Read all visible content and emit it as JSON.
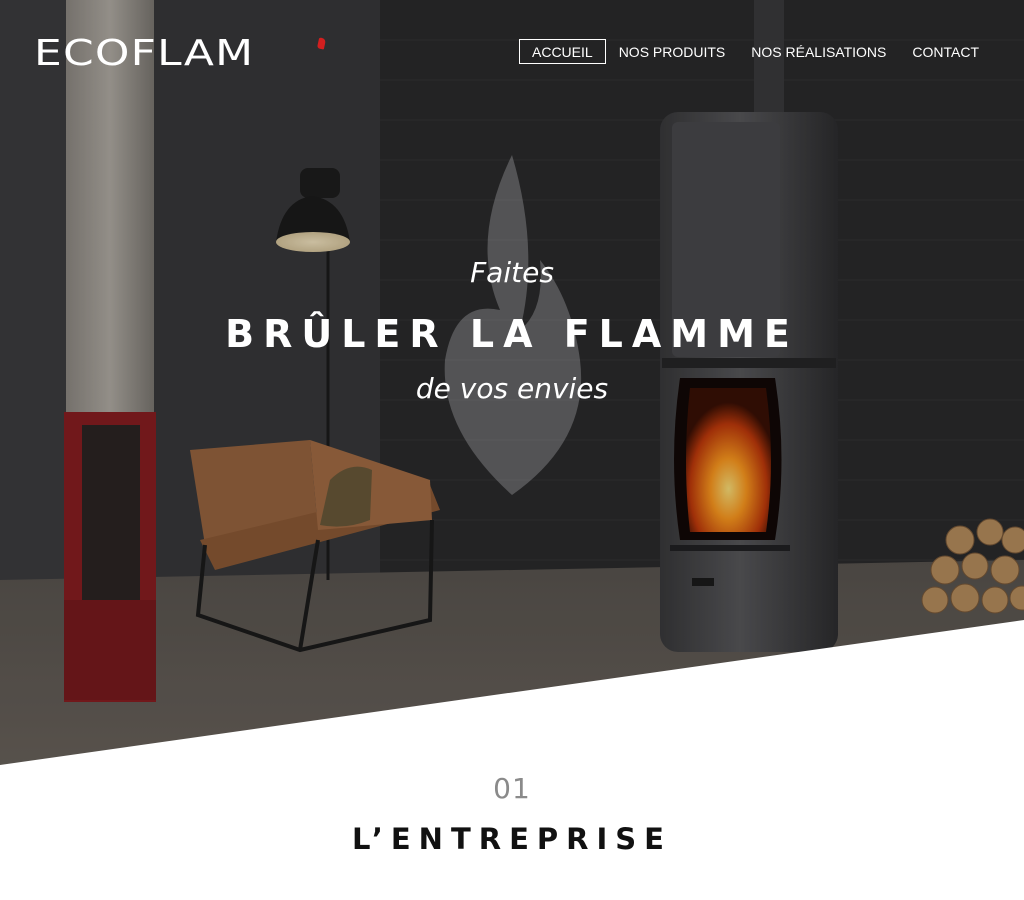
{
  "header": {
    "logo_text": "ECOFLAM",
    "nav": [
      {
        "label": "ACCUEIL",
        "active": true
      },
      {
        "label": "NOS PRODUITS",
        "active": false
      },
      {
        "label": "NOS RÉALISATIONS",
        "active": false
      },
      {
        "label": "CONTACT",
        "active": false
      }
    ]
  },
  "hero": {
    "line1": "Faites",
    "line2": "BRÛLER LA FLAMME",
    "line3": "de vos envies"
  },
  "section": {
    "number": "01",
    "title": "L’ENTREPRISE"
  },
  "colors": {
    "accent": "#d21f1f",
    "hero_dark": "#2c2c2e",
    "section_number": "#8a8a8a",
    "section_title": "#111111"
  }
}
